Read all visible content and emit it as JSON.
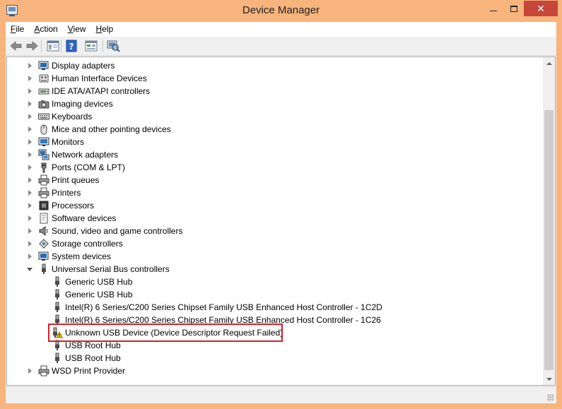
{
  "window": {
    "title": "Device Manager",
    "accent_color": "#f7b47c",
    "close_color": "#c7463a"
  },
  "menu": [
    {
      "label": "File",
      "mnemonic": "F",
      "rest": "ile"
    },
    {
      "label": "Action",
      "mnemonic": "A",
      "rest": "ction"
    },
    {
      "label": "View",
      "mnemonic": "V",
      "rest": "iew"
    },
    {
      "label": "Help",
      "mnemonic": "H",
      "rest": "elp"
    }
  ],
  "toolbar": {
    "icons": [
      "back-arrow-icon",
      "forward-arrow-icon",
      "properties-icon",
      "help-icon",
      "view-icon",
      "scan-hardware-icon"
    ]
  },
  "tree": {
    "categories": [
      {
        "label": "Display adapters",
        "icon": "display-adapter-icon",
        "expanded": false
      },
      {
        "label": "Human Interface Devices",
        "icon": "hid-icon",
        "expanded": false
      },
      {
        "label": "IDE ATA/ATAPI controllers",
        "icon": "ide-controller-icon",
        "expanded": false
      },
      {
        "label": "Imaging devices",
        "icon": "camera-icon",
        "expanded": false
      },
      {
        "label": "Keyboards",
        "icon": "keyboard-icon",
        "expanded": false
      },
      {
        "label": "Mice and other pointing devices",
        "icon": "mouse-icon",
        "expanded": false
      },
      {
        "label": "Monitors",
        "icon": "monitor-icon",
        "expanded": false
      },
      {
        "label": "Network adapters",
        "icon": "network-adapter-icon",
        "expanded": false
      },
      {
        "label": "Ports (COM & LPT)",
        "icon": "port-icon",
        "expanded": false
      },
      {
        "label": "Print queues",
        "icon": "printer-icon",
        "expanded": false
      },
      {
        "label": "Printers",
        "icon": "printer-icon",
        "expanded": false
      },
      {
        "label": "Processors",
        "icon": "processor-icon",
        "expanded": false
      },
      {
        "label": "Software devices",
        "icon": "software-device-icon",
        "expanded": false
      },
      {
        "label": "Sound, video and game controllers",
        "icon": "speaker-icon",
        "expanded": false
      },
      {
        "label": "Storage controllers",
        "icon": "storage-controller-icon",
        "expanded": false
      },
      {
        "label": "System devices",
        "icon": "system-device-icon",
        "expanded": false
      },
      {
        "label": "Universal Serial Bus controllers",
        "icon": "usb-icon",
        "expanded": true
      }
    ],
    "usb_children": [
      {
        "label": "Generic USB Hub",
        "icon": "usb-icon",
        "warning": false
      },
      {
        "label": "Generic USB Hub",
        "icon": "usb-icon",
        "warning": false
      },
      {
        "label": "Intel(R) 6 Series/C200 Series Chipset Family USB Enhanced Host Controller - 1C2D",
        "icon": "usb-icon",
        "warning": false
      },
      {
        "label": "Intel(R) 6 Series/C200 Series Chipset Family USB Enhanced Host Controller - 1C26",
        "icon": "usb-icon",
        "warning": false
      },
      {
        "label": "Unknown USB Device (Device Descriptor Request Failed)",
        "icon": "usb-warning-icon",
        "warning": true
      },
      {
        "label": "USB Root Hub",
        "icon": "usb-icon",
        "warning": false
      },
      {
        "label": "USB Root Hub",
        "icon": "usb-icon",
        "warning": false
      }
    ],
    "after": [
      {
        "label": "WSD Print Provider",
        "icon": "printer-icon",
        "expanded": false
      }
    ],
    "highlight_color": "#d6202a"
  }
}
